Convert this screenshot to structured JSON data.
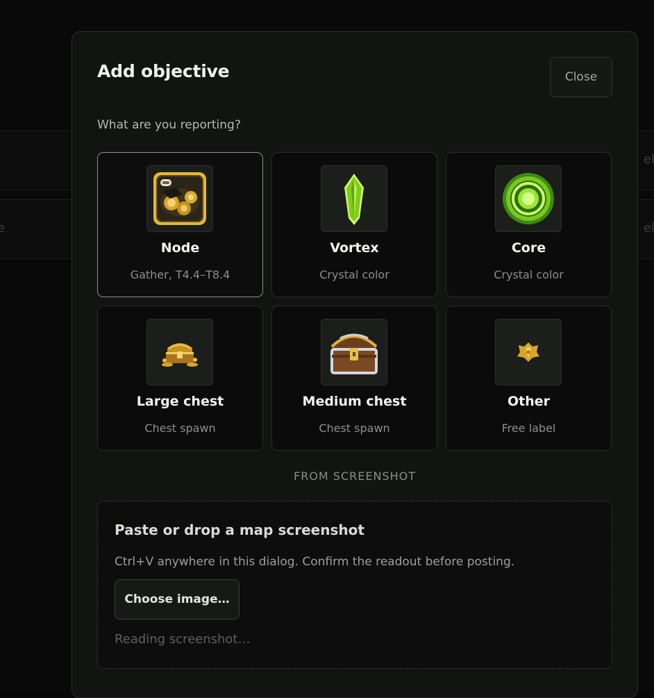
{
  "modal": {
    "title": "Add objective",
    "close_label": "Close",
    "prompt": "What are you reporting?"
  },
  "options": [
    {
      "label": "Node",
      "sub": "Gather, T4.4–T8.4",
      "icon": "resource-node-icon",
      "selected": true
    },
    {
      "label": "Vortex",
      "sub": "Crystal color",
      "icon": "green-crystal-icon",
      "selected": false
    },
    {
      "label": "Core",
      "sub": "Crystal color",
      "icon": "green-orb-icon",
      "selected": false
    },
    {
      "label": "Large chest",
      "sub": "Chest spawn",
      "icon": "small-gold-chest-icon",
      "selected": false
    },
    {
      "label": "Medium chest",
      "sub": "Chest spawn",
      "icon": "treasure-chest-icon",
      "selected": false
    },
    {
      "label": "Other",
      "sub": "Free label",
      "icon": "gold-crest-icon",
      "selected": false
    }
  ],
  "screenshot": {
    "section_label": "FROM SCREENSHOT",
    "title": "Paste or drop a map screenshot",
    "hint": "Ctrl+V anywhere in this dialog. Confirm the readout before posting.",
    "choose_label": "Choose image…",
    "status": "Reading screenshot…"
  },
  "colors": {
    "accent_green": "#8fe02c",
    "gold": "#d9a822",
    "panel": "#121412"
  }
}
